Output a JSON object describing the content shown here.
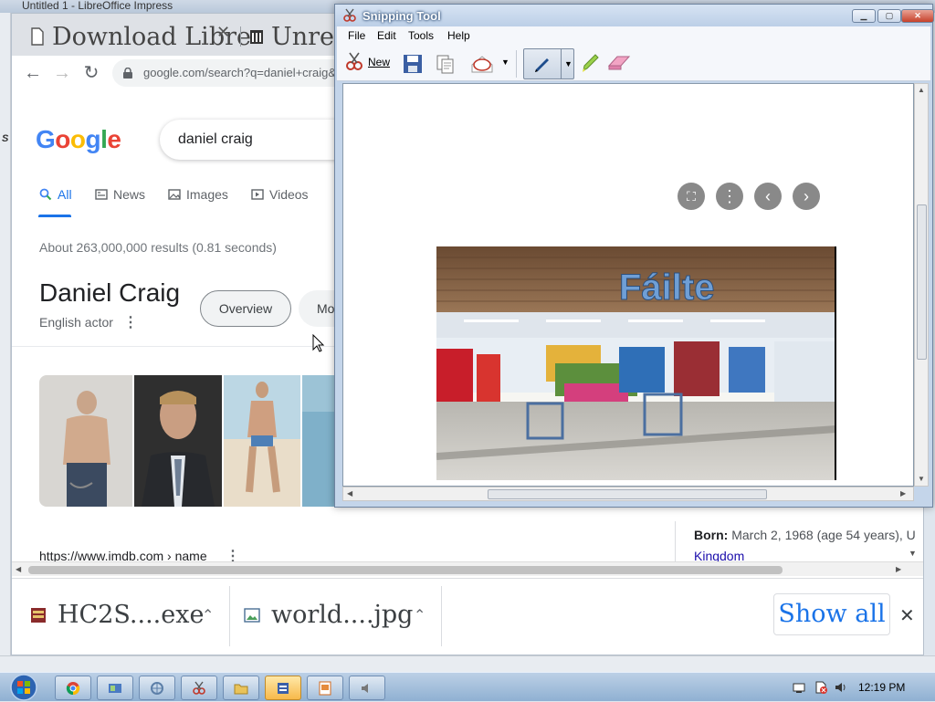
{
  "libreoffice": {
    "title": "Untitled 1 - LibreOffice Impress"
  },
  "chrome": {
    "tabs": [
      {
        "label": "Download Libre"
      },
      {
        "label": "Unreg"
      }
    ],
    "url": "google.com/search?q=daniel+craig&rlz",
    "search_page": {
      "logo": "Google",
      "query": "daniel craig",
      "tabs": [
        {
          "label": "All",
          "icon": "search-icon"
        },
        {
          "label": "News",
          "icon": "news-icon"
        },
        {
          "label": "Images",
          "icon": "image-icon"
        },
        {
          "label": "Videos",
          "icon": "video-icon"
        }
      ],
      "stats": "About 263,000,000 results (0.81 seconds)",
      "knowledge_panel": {
        "name": "Daniel Craig",
        "subtitle": "English actor",
        "chips": [
          "Overview",
          "Mo"
        ],
        "born_label": "Born:",
        "born_value": "March 2, 1968 (age 54 years), U",
        "born_place": "Kingdom"
      },
      "result_url": "https://www.imdb.com › name"
    },
    "downloads": [
      {
        "name": "HC2S....exe",
        "icon": "installer-icon"
      },
      {
        "name": "world....jpg",
        "icon": "image-file-icon"
      }
    ],
    "show_all_label": "Show all"
  },
  "snipping_tool": {
    "title": "Snipping Tool",
    "menu": [
      "File",
      "Edit",
      "Tools",
      "Help"
    ],
    "toolbar": {
      "new_label": "New"
    },
    "captured_sign": "Fáilte"
  },
  "taskbar": {
    "clock": "12:19 PM"
  },
  "colors": {
    "google_blue": "#4285F4",
    "google_red": "#EA4335",
    "google_yellow": "#FBBC05",
    "google_green": "#34A853",
    "link": "#1a0dab",
    "accent": "#1a73e8"
  }
}
